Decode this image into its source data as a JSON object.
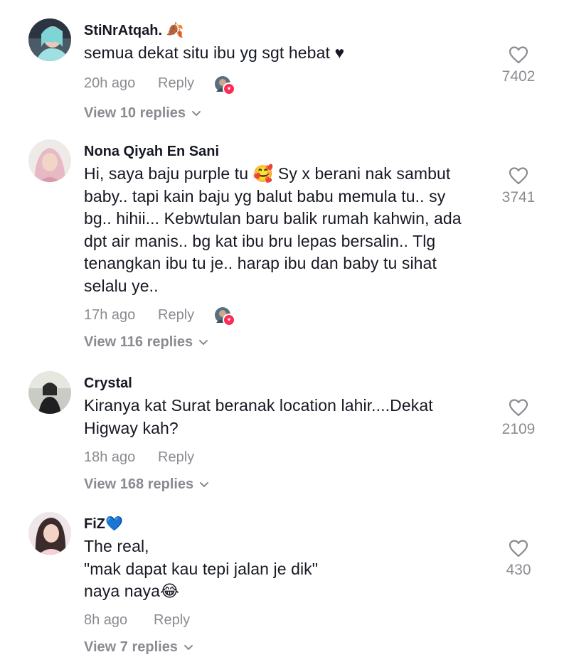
{
  "comments": [
    {
      "username": "StiNrAtqah. 🍂",
      "text": "semua dekat situ ibu yg sgt hebat ♥",
      "time": "20h ago",
      "reply": "Reply",
      "view_replies": "View 10 replies",
      "likes": "7402",
      "creator_liked": true
    },
    {
      "username": "Nona Qiyah En Sani",
      "text": "Hi, saya baju purple tu 🥰 Sy x berani nak sambut\nbaby.. tapi kain baju yg balut babu memula tu.. sy\nbg.. hihii... Kebwtulan baru balik rumah kahwin, ada\ndpt air manis.. bg kat ibu bru lepas bersalin.. Tlg\ntenangkan ibu tu je.. harap ibu dan baby tu sihat\nselalu ye..",
      "time": "17h ago",
      "reply": "Reply",
      "view_replies": "View 116 replies",
      "likes": "3741",
      "creator_liked": true
    },
    {
      "username": "Crystal",
      "text": "Kiranya kat Surat beranak location lahir....Dekat\nHigway kah?",
      "time": "18h ago",
      "reply": "Reply",
      "view_replies": "View 168 replies",
      "likes": "2109",
      "creator_liked": false
    },
    {
      "username": "FiZ💙",
      "text": "The real,\n\"mak dapat kau tepi jalan je dik\"\nnaya naya😂",
      "time": "8h ago",
      "reply": "Reply",
      "view_replies": "View 7 replies",
      "likes": "430",
      "creator_liked": false
    }
  ],
  "icons": {
    "like": "heart-outline-icon",
    "expand": "chevron-down-icon",
    "creator_liked_badge": "heart-icon"
  },
  "colors": {
    "text": "#161823",
    "secondary": "#8a8b91",
    "badge": "#fe2c55"
  }
}
